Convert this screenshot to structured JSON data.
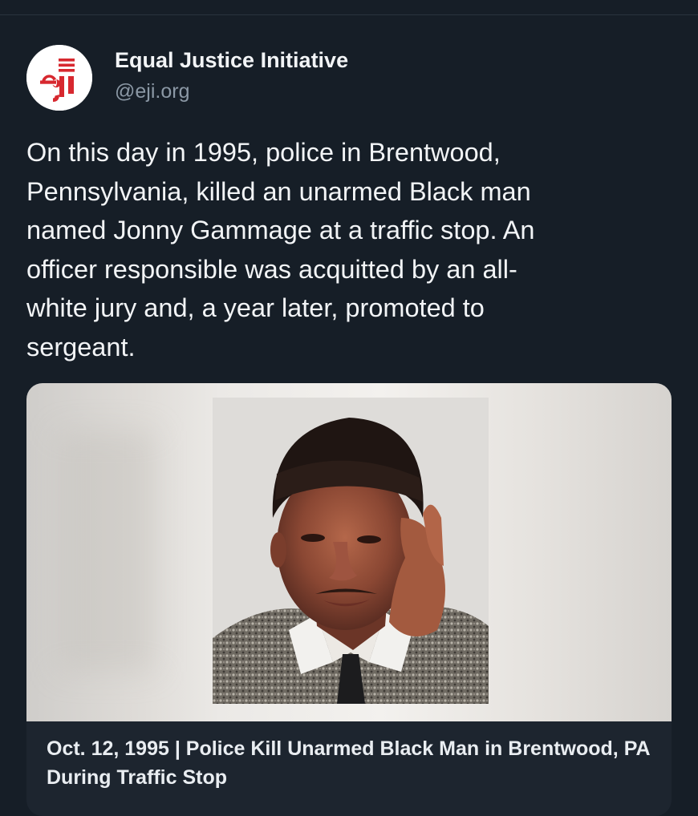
{
  "account": {
    "display_name": "Equal Justice Initiative",
    "handle": "@eji.org",
    "avatar_text": "eji",
    "avatar_color": "#d7282f"
  },
  "post": {
    "text": "On this day in 1995, police in Brentwood,\nPennsylvania, killed an unarmed Black man\nnamed Jonny Gammage at a traffic stop. An\nofficer responsible was acquitted by an all-\nwhite jury and, a year later, promoted to\nsergeant."
  },
  "link_card": {
    "image_icon": "portrait-photo",
    "title": "Oct. 12, 1995 | Police Kill Unarmed Black Man in Brentwood, PA During Traffic Stop"
  },
  "colors": {
    "background": "#161e27",
    "text": "#f2f4f6",
    "muted": "#8b98a5"
  }
}
